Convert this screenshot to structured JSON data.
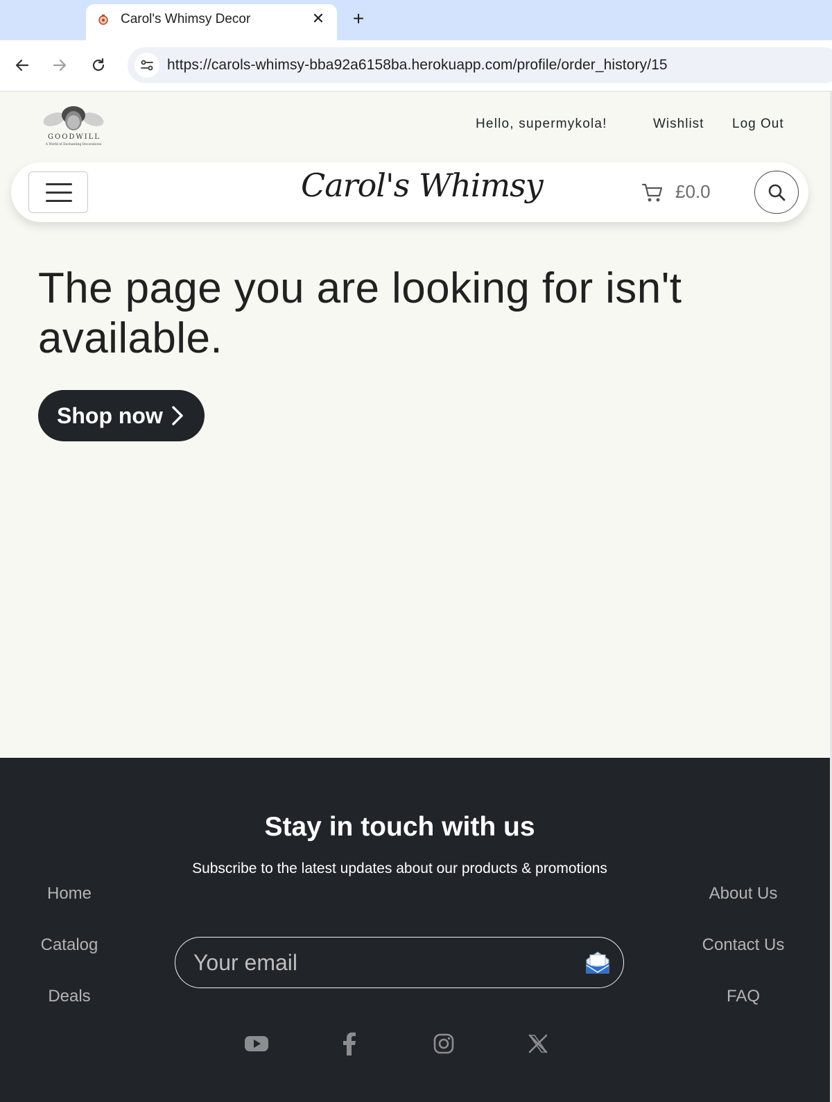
{
  "browser": {
    "tab_title": "Carol's Whimsy Decor",
    "tab_close": "✕",
    "new_tab": "+",
    "url": "https://carols-whimsy-bba92a6158ba.herokuapp.com/profile/order_history/15"
  },
  "header": {
    "logo_text": "GOODWILL",
    "logo_tagline": "A World of Enchanting Decorations",
    "greeting": "Hello, supermykola!",
    "wishlist": "Wishlist",
    "logout": "Log Out"
  },
  "navbar": {
    "wordmark": "Carol's Whimsy",
    "cart_total": "£0.0"
  },
  "main": {
    "headline": "The page you are looking for isn't available.",
    "shop_button": "Shop now"
  },
  "footer": {
    "title": "Stay in touch with us",
    "subtitle": "Subscribe to the latest updates about our products & promotions",
    "left_links": [
      "Home",
      "Catalog",
      "Deals"
    ],
    "right_links": [
      "About Us",
      "Contact Us",
      "FAQ"
    ],
    "email_placeholder": "Your email",
    "social": [
      "youtube-icon",
      "facebook-icon",
      "instagram-icon",
      "x-icon"
    ]
  },
  "colors": {
    "page_bg": "#f8f8f3",
    "footer_bg": "#212529",
    "tabstrip_bg": "#d3e3fd"
  }
}
